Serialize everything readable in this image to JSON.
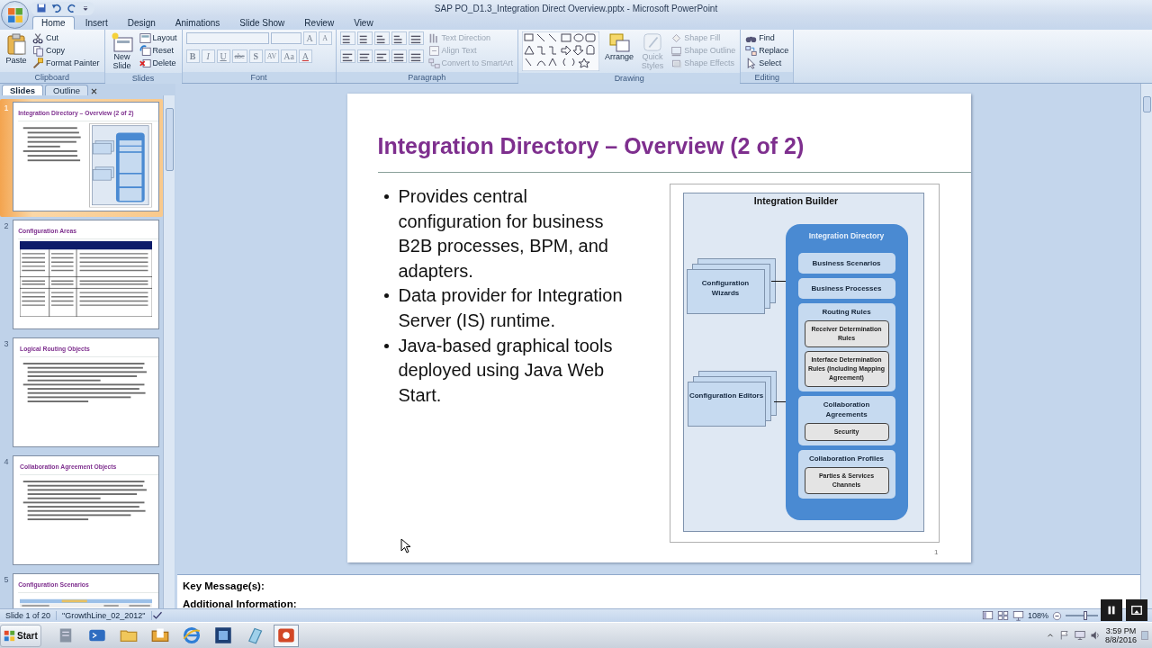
{
  "window": {
    "title": "SAP PO_D1.3_Integration Direct Overview.pptx - Microsoft PowerPoint"
  },
  "ribbon_tabs": [
    {
      "label": "Home",
      "selected": true
    },
    {
      "label": "Insert",
      "selected": false
    },
    {
      "label": "Design",
      "selected": false
    },
    {
      "label": "Animations",
      "selected": false
    },
    {
      "label": "Slide Show",
      "selected": false
    },
    {
      "label": "Review",
      "selected": false
    },
    {
      "label": "View",
      "selected": false
    }
  ],
  "ribbon": {
    "clipboard": {
      "label": "Clipboard",
      "paste": "Paste",
      "items": [
        "Cut",
        "Copy",
        "Format Painter"
      ]
    },
    "slides": {
      "label": "Slides",
      "new_slide": "New Slide",
      "items": [
        "Layout",
        "Reset",
        "Delete"
      ]
    },
    "font": {
      "label": "Font",
      "size_buttons": [
        "A",
        "A"
      ],
      "buttons": [
        {
          "kind": "bold",
          "label": "B"
        },
        {
          "kind": "italic",
          "label": "I"
        },
        {
          "kind": "underline",
          "label": "U"
        },
        {
          "kind": "strike",
          "label": "abc"
        },
        {
          "kind": "shadow",
          "label": "S"
        },
        {
          "kind": "spacing",
          "label": "AV"
        },
        {
          "kind": "case",
          "label": "Aa"
        },
        {
          "kind": "color",
          "label": "A"
        }
      ]
    },
    "paragraph": {
      "label": "Paragraph",
      "items": [
        {
          "label": "Text Direction",
          "disabled": true
        },
        {
          "label": "Align Text",
          "disabled": true
        },
        {
          "label": "Convert to SmartArt",
          "disabled": true
        }
      ]
    },
    "drawing": {
      "label": "Drawing",
      "arrange": "Arrange",
      "quick_styles": {
        "label": "Quick Styles",
        "disabled": true
      },
      "items": [
        {
          "label": "Shape Fill",
          "disabled": true
        },
        {
          "label": "Shape Outline",
          "disabled": true
        },
        {
          "label": "Shape Effects",
          "disabled": true
        }
      ]
    },
    "editing": {
      "label": "Editing",
      "items": [
        "Find",
        "Replace",
        "Select"
      ]
    }
  },
  "slides_panel": {
    "tabs": [
      {
        "label": "Slides",
        "selected": true
      },
      {
        "label": "Outline",
        "selected": false
      }
    ],
    "thumbnails": [
      {
        "number": "1",
        "selected": true,
        "kind": "diagram",
        "title": "Integration Directory – Overview (2 of 2)"
      },
      {
        "number": "2",
        "selected": false,
        "kind": "table",
        "title": "Configuration Areas"
      },
      {
        "number": "3",
        "selected": false,
        "kind": "text",
        "title": "Logical Routing Objects"
      },
      {
        "number": "4",
        "selected": false,
        "kind": "text",
        "title": "Collaboration Agreement Objects"
      },
      {
        "number": "5",
        "selected": false,
        "kind": "screenshot",
        "title": "Configuration Scenarios"
      }
    ]
  },
  "slide": {
    "title": "Integration Directory – Overview (2 of 2)",
    "bullets": [
      "Provides central configuration for business B2B processes, BPM, and adapters.",
      "Data provider for Integration Server (IS) runtime.",
      "Java-based graphical tools deployed using Java Web Start."
    ],
    "page_number": "1",
    "diagram": {
      "title": "Integration Builder",
      "tools": [
        "Configuration Wizards",
        "Configuration Editors"
      ],
      "directory": {
        "title": "Integration Directory",
        "sections": [
          {
            "title": "Business Scenarios"
          },
          {
            "title": "Business Processes"
          },
          {
            "title": "Routing Rules",
            "items": [
              "Receiver Determination Rules",
              "Interface Determination Rules (Including Mapping Agreement)"
            ]
          },
          {
            "title": "Collaboration Agreements",
            "items": [
              "Security"
            ]
          },
          {
            "title": "Collaboration Profiles",
            "items": [
              "Parties & Services Channels"
            ]
          }
        ]
      }
    }
  },
  "notes": [
    "Key Message(s):",
    "Additional Information:"
  ],
  "status_bar": {
    "slide_info": "Slide 1 of 20",
    "theme": "\"GrowthLine_02_2012\"",
    "zoom": "108%",
    "zoom_slider": {
      "level": 0.6
    }
  },
  "taskbar": {
    "start": "Start",
    "time": "3:59 PM",
    "date": "8/8/2016"
  }
}
